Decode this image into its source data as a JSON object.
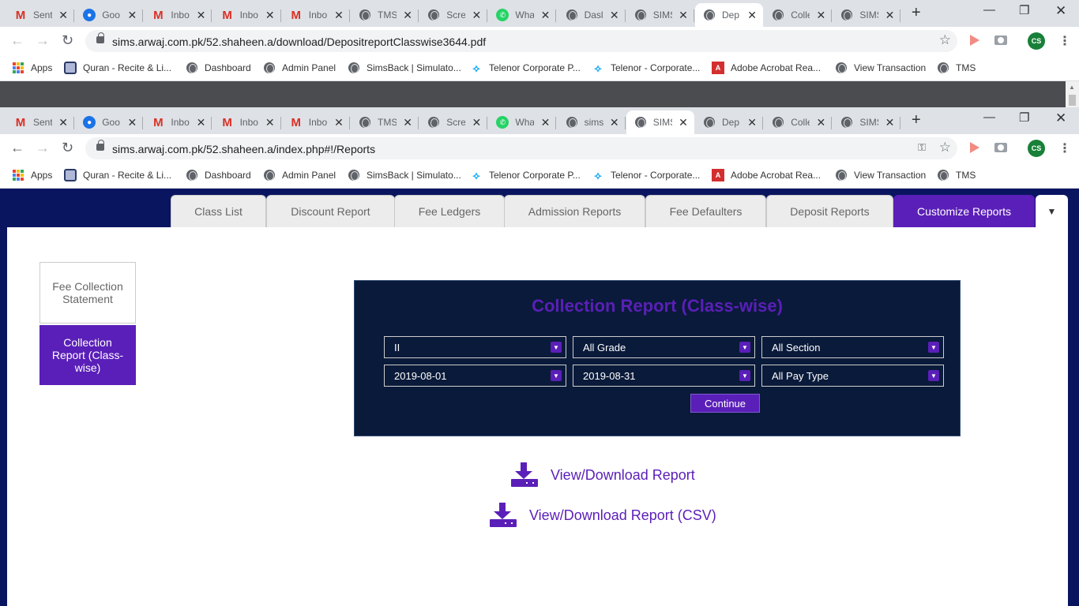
{
  "browser_top": {
    "tabs": [
      {
        "icon": "gmail-icon",
        "title": "Sent"
      },
      {
        "icon": "google-account-icon",
        "title": "Goo"
      },
      {
        "icon": "gmail-icon",
        "title": "Inbo"
      },
      {
        "icon": "gmail-icon",
        "title": "Inbo"
      },
      {
        "icon": "gmail-icon",
        "title": "Inbo"
      },
      {
        "icon": "globe-icon",
        "title": "TMS"
      },
      {
        "icon": "globe-icon",
        "title": "Scre"
      },
      {
        "icon": "whatsapp-icon",
        "title": "Wha"
      },
      {
        "icon": "globe-icon",
        "title": "Dasl"
      },
      {
        "icon": "globe-icon",
        "title": "SIMS"
      },
      {
        "icon": "globe-icon",
        "title": "Dep",
        "active": true
      },
      {
        "icon": "globe-icon",
        "title": "Colle"
      },
      {
        "icon": "globe-icon",
        "title": "SIMS"
      }
    ],
    "url": "sims.arwaj.com.pk/52.shaheen.a/download/DepositreportClasswise3644.pdf"
  },
  "browser_bottom": {
    "tabs": [
      {
        "icon": "gmail-icon",
        "title": "Sent"
      },
      {
        "icon": "google-account-icon",
        "title": "Goo"
      },
      {
        "icon": "gmail-icon",
        "title": "Inbo"
      },
      {
        "icon": "gmail-icon",
        "title": "Inbo"
      },
      {
        "icon": "gmail-icon",
        "title": "Inbo"
      },
      {
        "icon": "globe-icon",
        "title": "TMS"
      },
      {
        "icon": "globe-icon",
        "title": "Scre"
      },
      {
        "icon": "whatsapp-icon",
        "title": "Wha"
      },
      {
        "icon": "globe-icon",
        "title": "sims"
      },
      {
        "icon": "globe-icon",
        "title": "SIMS",
        "active": true
      },
      {
        "icon": "globe-icon",
        "title": "Dep"
      },
      {
        "icon": "globe-icon",
        "title": "Colle"
      },
      {
        "icon": "globe-icon",
        "title": "SIMS"
      }
    ],
    "url": "sims.arwaj.com.pk/52.shaheen.a/index.php#!/Reports"
  },
  "profile_initials": "CS",
  "bookmarks": [
    {
      "icon": "apps-grid-icon",
      "label": "Apps"
    },
    {
      "icon": "quran-icon",
      "label": "Quran - Recite & Li..."
    },
    {
      "icon": "globe-icon",
      "label": "Dashboard"
    },
    {
      "icon": "globe-icon",
      "label": "Admin Panel"
    },
    {
      "icon": "globe-icon",
      "label": "SimsBack | Simulato..."
    },
    {
      "icon": "telenor-icon",
      "label": "Telenor Corporate P..."
    },
    {
      "icon": "telenor-icon",
      "label": "Telenor - Corporate..."
    },
    {
      "icon": "adobe-acrobat-icon",
      "label": "Adobe Acrobat Rea..."
    },
    {
      "icon": "globe-icon",
      "label": "View Transaction"
    },
    {
      "icon": "globe-icon",
      "label": "TMS"
    }
  ],
  "nav_tabs": [
    "Class List",
    "Discount Report",
    "Fee Ledgers",
    "Admission Reports",
    "Fee Defaulters",
    "Deposit Reports",
    "Customize Reports"
  ],
  "active_nav_tab": "Customize Reports",
  "sidebar": {
    "items": [
      "Fee Collection Statement",
      "Collection Report (Class-wise)"
    ],
    "active": "Collection Report (Class-wise)"
  },
  "report": {
    "title": "Collection Report (Class-wise)",
    "class_select": "II",
    "grade_select": "All Grade",
    "section_select": "All Section",
    "from_date": "2019-08-01",
    "to_date": "2019-08-31",
    "pay_type_select": "All Pay Type",
    "continue_label": "Continue"
  },
  "downloads": {
    "pdf_label": "View/Download Report",
    "csv_label": "View/Download Report (CSV)"
  },
  "colors": {
    "accent": "#5a1fb8",
    "app_background": "#0a1560",
    "report_panel": "#0a1a3a"
  }
}
